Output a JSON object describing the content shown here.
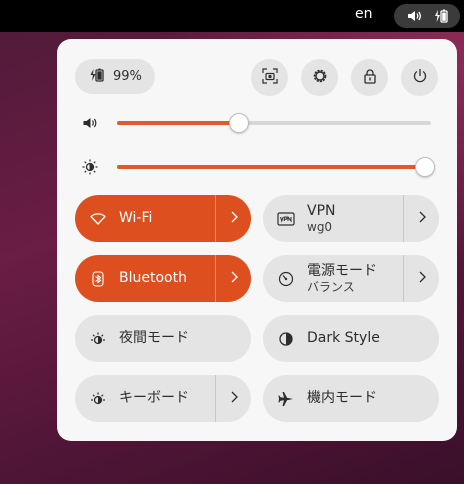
{
  "topbar": {
    "language": "en"
  },
  "battery": {
    "percent": "99%"
  },
  "volume": {
    "level": 0.39
  },
  "brightness": {
    "level": 0.98
  },
  "tiles": {
    "wifi": {
      "label": "Wi-Fi"
    },
    "vpn": {
      "label": "VPN",
      "sub": "wg0"
    },
    "bluetooth": {
      "label": "Bluetooth"
    },
    "power_mode": {
      "label": "電源モード",
      "sub": "バランス"
    },
    "night_mode": {
      "label": "夜間モード"
    },
    "dark_style": {
      "label": "Dark Style"
    },
    "keyboard": {
      "label": "キーボード"
    },
    "airplane": {
      "label": "機内モード"
    }
  },
  "colors": {
    "accent": "#dd4f1e",
    "panel": "#f7f7f7",
    "tile": "#e4e4e4"
  }
}
